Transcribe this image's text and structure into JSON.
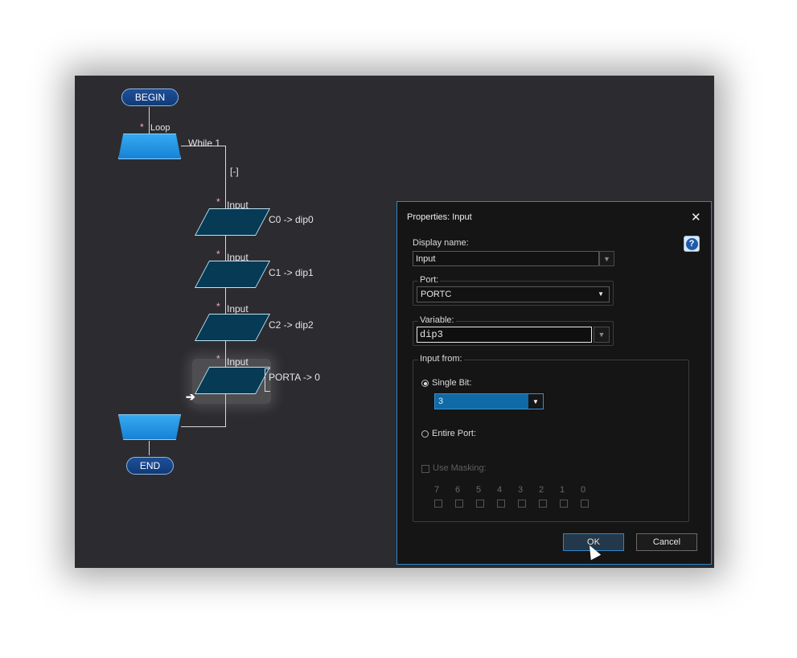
{
  "flowchart": {
    "begin_label": "BEGIN",
    "end_label": "END",
    "loop": {
      "star": "*",
      "name": "Loop",
      "condition": "While 1",
      "collapse": "[-]"
    },
    "inputs": [
      {
        "star": "*",
        "name": "Input",
        "mapping": "C0 -> dip0"
      },
      {
        "star": "*",
        "name": "Input",
        "mapping": "C1 -> dip1"
      },
      {
        "star": "*",
        "name": "Input",
        "mapping": "C2 -> dip2"
      },
      {
        "star": "*",
        "name": "Input",
        "mapping": "PORTA -> 0"
      }
    ],
    "insert_arrow": "➔"
  },
  "dialog": {
    "title": "Properties: Input",
    "close_symbol": "✕",
    "help_symbol": "?",
    "display_name_label": "Display name:",
    "display_name_value": "Input",
    "port_label": "Port:",
    "port_value": "PORTC",
    "variable_label": "Variable:",
    "variable_value": "dip3",
    "input_from_label": "Input from:",
    "single_bit_label": "Single Bit:",
    "single_bit_value": "3",
    "entire_port_label": "Entire Port:",
    "use_masking_label": "Use Masking:",
    "bits": [
      "7",
      "6",
      "5",
      "4",
      "3",
      "2",
      "1",
      "0"
    ],
    "ok_label": "OK",
    "cancel_label": "Cancel",
    "dropdown_arrow": "▼"
  }
}
